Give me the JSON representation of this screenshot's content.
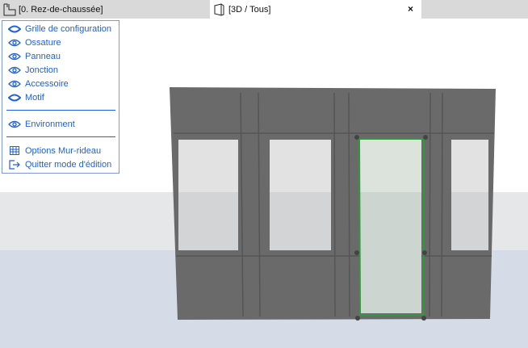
{
  "tabs": [
    {
      "label": "[0. Rez-de-chaussée]",
      "icon": "floor-plan-icon",
      "active": false
    },
    {
      "label": "[3D / Tous]",
      "icon": "3d-view-icon",
      "active": true
    }
  ],
  "close_label": "×",
  "menu": {
    "group1": [
      {
        "label": "Grille de configuration",
        "icon": "eye-closed-icon"
      },
      {
        "label": "Ossature",
        "icon": "eye-icon"
      },
      {
        "label": "Panneau",
        "icon": "eye-icon"
      },
      {
        "label": "Jonction",
        "icon": "eye-icon"
      },
      {
        "label": "Accessoire",
        "icon": "eye-icon"
      },
      {
        "label": "Motif",
        "icon": "eye-closed-icon"
      }
    ],
    "group2": [
      {
        "label": "Environment",
        "icon": "eye-icon"
      }
    ],
    "group3": [
      {
        "label": "Options Mur-rideau",
        "icon": "curtain-wall-icon"
      },
      {
        "label": "Quitter mode d'édition",
        "icon": "exit-icon"
      }
    ]
  },
  "colors": {
    "accent": "#1f5fe0",
    "selection": "#2e9a3a",
    "frame": "#6b6a6b"
  }
}
